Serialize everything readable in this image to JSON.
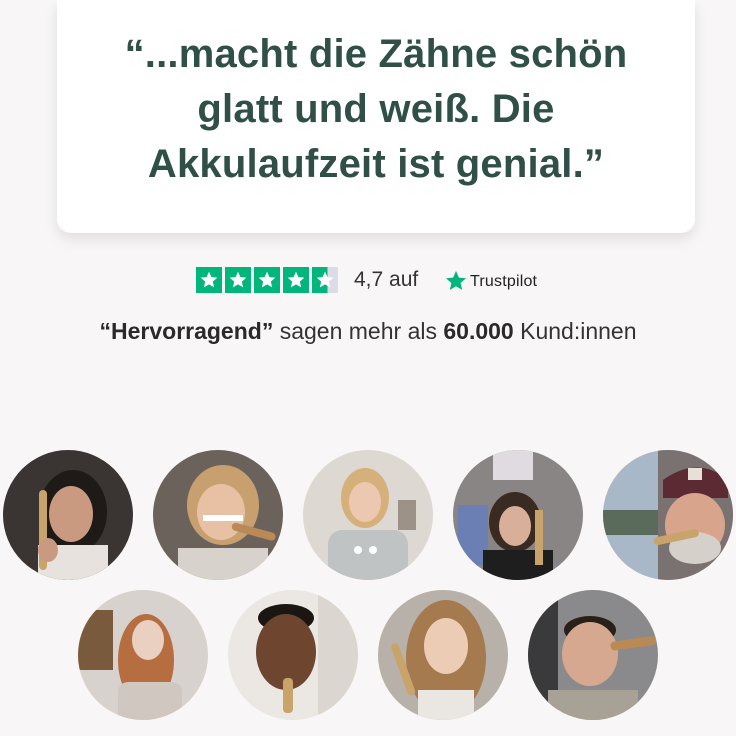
{
  "quote": {
    "lines": [
      "“...macht die Zähne schön",
      "glatt und weiß. Die",
      "Akkulaufzeit ist genial.”"
    ]
  },
  "rating": {
    "score_text": "4,7 auf",
    "provider": "Trustpilot",
    "stars": 4.7,
    "star_color": "#00b67a"
  },
  "summary": {
    "quote_word": "“Hervorragend”",
    "middle": " sagen mehr als ",
    "count": "60.000",
    "tail": " Kund:innen"
  },
  "colors": {
    "headline": "#2f4f47",
    "background": "#f8f6f6",
    "card": "#ffffff"
  },
  "avatars": [
    {
      "name": "customer-photo-1"
    },
    {
      "name": "customer-photo-2"
    },
    {
      "name": "customer-photo-3"
    },
    {
      "name": "customer-photo-4"
    },
    {
      "name": "customer-photo-5"
    },
    {
      "name": "customer-photo-6"
    },
    {
      "name": "customer-photo-7"
    },
    {
      "name": "customer-photo-8"
    },
    {
      "name": "customer-photo-9"
    }
  ]
}
